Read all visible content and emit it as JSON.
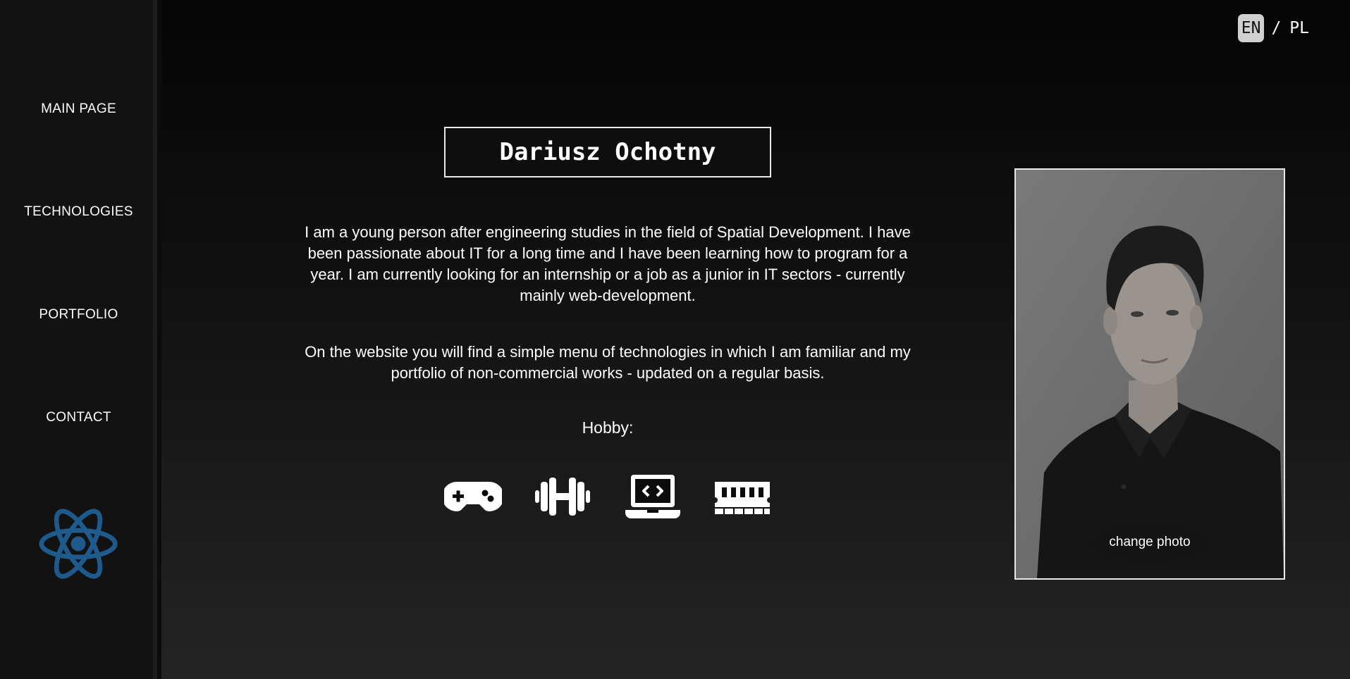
{
  "sidebar": {
    "items": [
      {
        "label": "MAIN PAGE"
      },
      {
        "label": "TECHNOLOGIES"
      },
      {
        "label": "PORTFOLIO"
      },
      {
        "label": "CONTACT"
      }
    ],
    "logo_icon": "atom-icon",
    "logo_color": "#1e5a8c"
  },
  "language": {
    "active": "EN",
    "separator": "/",
    "other": "PL"
  },
  "profile": {
    "name": "Dariusz Ochotny",
    "intro": "I am a young person after engineering studies in the field of Spatial Development. I have been passionate about IT for a long time and I have been learning how to program for a year. I am currently looking for an internship or a job as a junior in IT sectors - currently mainly web-development.",
    "website_note": "On the website you will find a simple menu of technologies in which I am familiar and my portfolio of non-commercial works - updated on a regular basis.",
    "hobby_label": "Hobby:",
    "hobby_icons": [
      "gamepad-icon",
      "dumbbell-icon",
      "laptop-code-icon",
      "memory-icon"
    ]
  },
  "photo": {
    "change_label": "change photo"
  },
  "colors": {
    "sidebar_bg": "#121212",
    "accent": "#1e5a8c"
  }
}
